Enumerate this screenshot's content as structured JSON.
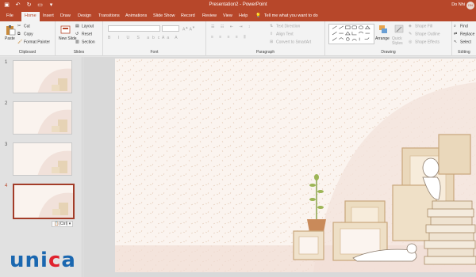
{
  "titlebar": {
    "document_title": "Presentation2 - PowerPoint",
    "user_name": "Do Nhi",
    "user_initials": "DN"
  },
  "tabs": [
    "File",
    "Home",
    "Insert",
    "Draw",
    "Design",
    "Transitions",
    "Animations",
    "Slide Show",
    "Record",
    "Review",
    "View",
    "Help"
  ],
  "tell_me": {
    "placeholder": "Tell me what you want to do",
    "icon": "lightbulb-icon"
  },
  "ribbon": {
    "clipboard": {
      "label": "Clipboard",
      "paste": "Paste",
      "cut": "Cut",
      "copy": "Copy",
      "format_painter": "Format Painter"
    },
    "slides": {
      "label": "Slides",
      "new_slide": "New Slide",
      "layout": "Layout",
      "reset": "Reset",
      "section": "Section"
    },
    "font": {
      "label": "Font"
    },
    "paragraph": {
      "label": "Paragraph",
      "text_direction": "Text Direction",
      "align_text": "Align Text",
      "convert_smartart": "Convert to SmartArt"
    },
    "drawing": {
      "label": "Drawing",
      "arrange": "Arrange",
      "quick_styles": "Quick Styles",
      "shape_fill": "Shape Fill",
      "shape_outline": "Shape Outline",
      "shape_effects": "Shape Effects"
    },
    "editing": {
      "label": "Editing",
      "find": "Find",
      "replace": "Replace",
      "select": "Select"
    }
  },
  "slides": [
    {
      "number": "1",
      "selected": false
    },
    {
      "number": "2",
      "selected": false
    },
    {
      "number": "3",
      "selected": false
    },
    {
      "number": "4",
      "selected": true
    }
  ],
  "paste_options": "(Ctrl)",
  "watermark": {
    "letters": [
      "u",
      "n",
      "i",
      "c",
      "a"
    ]
  },
  "colors": {
    "brand": "#b7472a",
    "ribbon": "#f3f3f3",
    "slide_bg": "#fbf4ef",
    "logo_blue": "#1a67b0",
    "logo_red": "#e0222e"
  }
}
